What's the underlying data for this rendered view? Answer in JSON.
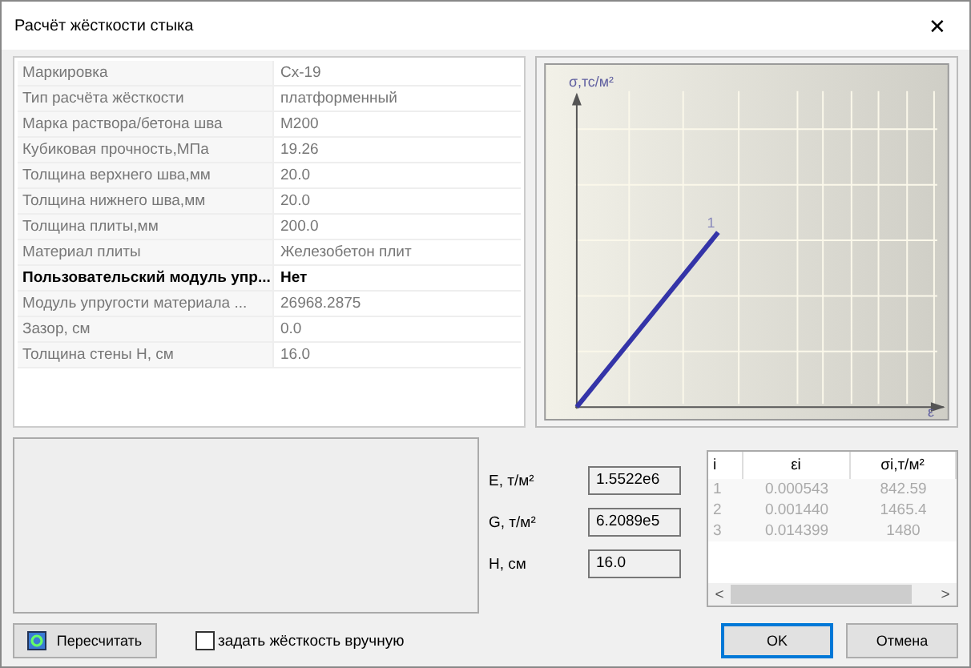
{
  "window": {
    "title": "Расчёт жёсткости стыка",
    "close": "✕"
  },
  "properties": [
    {
      "name": "Маркировка",
      "value": "Сх-19",
      "disabled": true
    },
    {
      "name": "Тип расчёта жёсткости",
      "value": "платформенный",
      "disabled": true
    },
    {
      "name": "Марка раствора/бетона шва",
      "value": "М200",
      "disabled": true
    },
    {
      "name": "Кубиковая прочность,МПа",
      "value": "19.26",
      "disabled": true
    },
    {
      "name": "Толщина верхнего шва,мм",
      "value": "20.0",
      "disabled": true
    },
    {
      "name": "Толщина нижнего шва,мм",
      "value": "20.0",
      "disabled": true
    },
    {
      "name": "Толщина плиты,мм",
      "value": "200.0",
      "disabled": true
    },
    {
      "name": "Материал плиты",
      "value": "Железобетон плит",
      "disabled": true
    },
    {
      "name": "Пользовательский модуль упр...",
      "value": "Нет",
      "disabled": false
    },
    {
      "name": "Модуль упругости материала ...",
      "value": "26968.2875",
      "disabled": true
    },
    {
      "name": "Зазор, см",
      "value": "0.0",
      "disabled": true
    },
    {
      "name": "Толщина стены H, см",
      "value": "16.0",
      "disabled": true
    }
  ],
  "chart": {
    "y_axis_label": "σ,тс/м²",
    "x_axis_label": "ε",
    "point_label": "1"
  },
  "fields": [
    {
      "label": "E, т/м²",
      "value": "1.5522e6"
    },
    {
      "label": "G, т/м²",
      "value": "6.2089e5"
    },
    {
      "label": "H, см",
      "value": "16.0"
    }
  ],
  "table": {
    "columns": [
      "i",
      "εi",
      "σi,т/м²"
    ],
    "rows": [
      [
        "1",
        "0.000543",
        "842.59"
      ],
      [
        "2",
        "0.001440",
        "1465.4"
      ],
      [
        "3",
        "0.014399",
        "1480"
      ]
    ],
    "scroll_left": "<",
    "scroll_right": ">"
  },
  "recalc_button": "Пересчитать",
  "manual_checkbox": {
    "label": "задать жёсткость вручную",
    "checked": false
  },
  "buttons": [
    {
      "label": "OK",
      "default": true
    },
    {
      "label": "Отмена",
      "default": false
    }
  ]
}
